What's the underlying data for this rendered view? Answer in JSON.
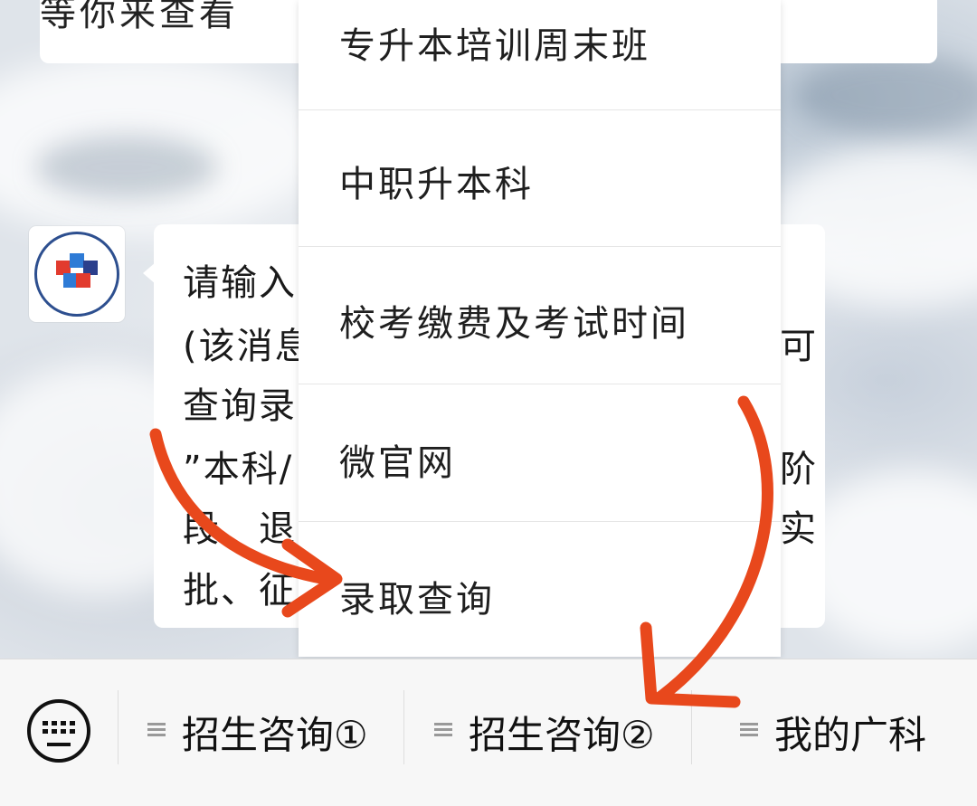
{
  "chat": {
    "previous_message_fragment": "等你来查看",
    "message_lines": [
      "请输入",
      "(该消息",
      "查询录",
      "”本科/",
      "段、退",
      "批、征"
    ],
    "message_right_fragments": [
      "",
      "可",
      "",
      "阶",
      "实",
      ""
    ]
  },
  "popup_menu": {
    "items": [
      {
        "label": "专升本培训周末班"
      },
      {
        "label": "中职升本科"
      },
      {
        "label": "校考缴费及考试时间"
      },
      {
        "label": "微官网"
      },
      {
        "label": "录取查询"
      }
    ]
  },
  "bottom_menu": {
    "keyboard_icon": "keyboard-icon",
    "buttons": [
      {
        "label": "招生咨询①",
        "icon": "menu-lines-icon"
      },
      {
        "label": "招生咨询②",
        "icon": "menu-lines-icon"
      },
      {
        "label": "我的广科",
        "icon": "menu-lines-icon"
      }
    ]
  },
  "colors": {
    "annotation_arrow": "#e8481c",
    "menu_text": "#1f1f1f",
    "bar_background": "#f7f7f7"
  }
}
